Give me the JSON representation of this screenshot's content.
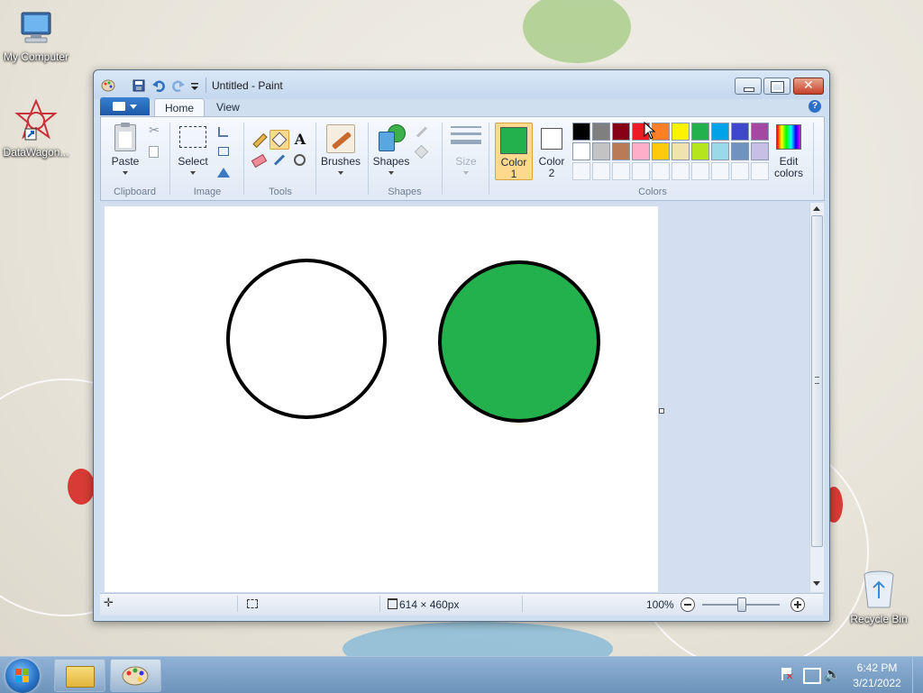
{
  "desktop": {
    "icons": [
      {
        "label": "My Computer",
        "icon": "computer-icon"
      },
      {
        "label": "DataWagon...",
        "icon": "datawagon-shortcut-icon"
      },
      {
        "label": "Recycle Bin",
        "icon": "recycle-bin-icon"
      }
    ]
  },
  "window": {
    "title": "Untitled - Paint",
    "tabs": [
      {
        "label": "Home",
        "active": true
      },
      {
        "label": "View",
        "active": false
      }
    ],
    "ribbon": {
      "clipboard": {
        "group_label": "Clipboard",
        "paste_label": "Paste"
      },
      "image": {
        "group_label": "Image",
        "select_label": "Select"
      },
      "tools": {
        "group_label": "Tools"
      },
      "shapes": {
        "group_label": "Shapes",
        "brushes_label": "Brushes",
        "shapes_label": "Shapes"
      },
      "size": {
        "label": "Size"
      },
      "colors": {
        "group_label": "Colors",
        "color1_label_line1": "Color",
        "color1_label_line2": "1",
        "color2_label_line1": "Color",
        "color2_label_line2": "2",
        "edit_colors_line1": "Edit",
        "edit_colors_line2": "colors",
        "color1_value": "#22b14c",
        "color2_value": "#ffffff",
        "palette_row1": [
          "#000000",
          "#7f7f7f",
          "#880015",
          "#ed1c24",
          "#ff7f27",
          "#fff200",
          "#22b14c",
          "#00a2e8",
          "#3f48cc",
          "#a349a4"
        ],
        "palette_row2": [
          "#ffffff",
          "#c3c3c3",
          "#b97a57",
          "#ffaec9",
          "#ffc90e",
          "#efe4b0",
          "#b5e61d",
          "#99d9ea",
          "#7092be",
          "#c8bfe7"
        ]
      }
    },
    "canvas": {
      "circles": [
        {
          "fill": "#ffffff",
          "stroke": "#000000"
        },
        {
          "fill": "#22b14c",
          "stroke": "#000000"
        }
      ]
    },
    "statusbar": {
      "dimensions": "614 × 460px",
      "zoom": "100%"
    }
  },
  "taskbar": {
    "time": "6:42 PM",
    "date": "3/21/2022"
  }
}
